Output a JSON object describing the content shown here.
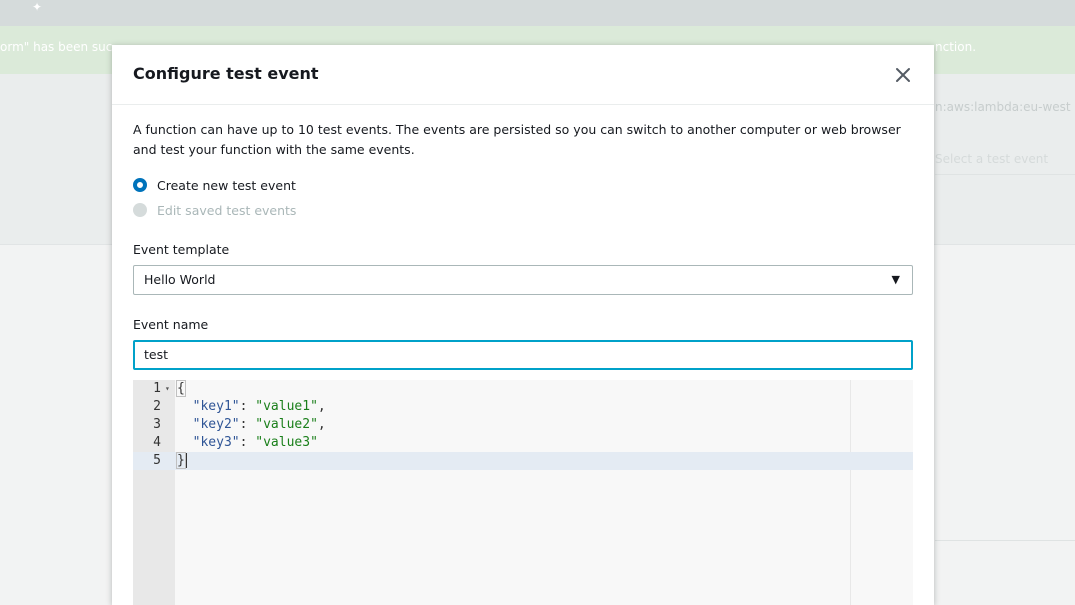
{
  "background": {
    "banner_left": "orm\" has been suc",
    "banner_right": "nction.",
    "arn_text": "n:aws:lambda:eu-west",
    "select_placeholder": "Select a test event"
  },
  "modal": {
    "title": "Configure test event",
    "description": "A function can have up to 10 test events. The events are persisted so you can switch to another computer or web browser and test your function with the same events.",
    "radio_options": [
      {
        "label": "Create new test event",
        "selected": true
      },
      {
        "label": "Edit saved test events",
        "selected": false
      }
    ],
    "event_template": {
      "label": "Event template",
      "value": "Hello World"
    },
    "event_name": {
      "label": "Event name",
      "value": "test"
    },
    "editor": {
      "lines": [
        {
          "number": "1",
          "key": "",
          "value": "",
          "text": "{"
        },
        {
          "number": "2",
          "key": "\"key1\"",
          "value": "\"value1\"",
          "suffix": ","
        },
        {
          "number": "3",
          "key": "\"key2\"",
          "value": "\"value2\"",
          "suffix": ","
        },
        {
          "number": "4",
          "key": "\"key3\"",
          "value": "\"value3\"",
          "suffix": ""
        },
        {
          "number": "5",
          "key": "",
          "value": "",
          "text": "}"
        }
      ]
    }
  },
  "colors": {
    "accent": "#0073bb",
    "focus": "#00a1c9",
    "banner": "#dbead9"
  },
  "icons": {
    "close": "close-icon",
    "caret": "caret-down-icon",
    "fold": "fold-arrow-icon"
  }
}
